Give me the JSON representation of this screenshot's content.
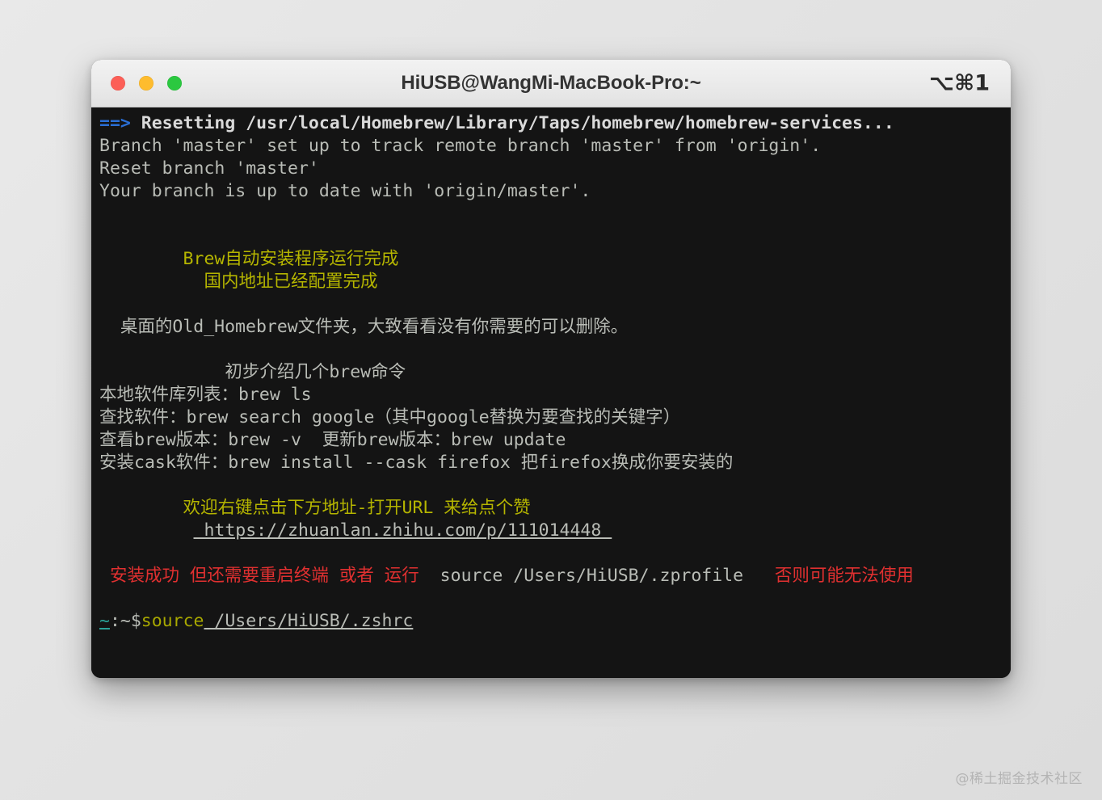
{
  "window": {
    "title": "HiUSB@WangMi-MacBook-Pro:~",
    "shortcut_badge": "⌥⌘1",
    "traffic_lights": {
      "close_label": "close",
      "minimize_label": "minimize",
      "maximize_label": "maximize",
      "close_color": "#fc5f57",
      "minimize_color": "#febc2e",
      "maximize_color": "#2bc840"
    }
  },
  "terminal": {
    "background_color": "#141414",
    "default_text_color": "#b9bcb6",
    "lines": {
      "l1_prefix": "==>",
      "l1_text": " Resetting /usr/local/Homebrew/Library/Taps/homebrew/homebrew-services...",
      "l2": "Branch 'master' set up to track remote branch 'master' from 'origin'.",
      "l3": "Reset branch 'master'",
      "l4": "Your branch is up to date with 'origin/master'.",
      "l5": "        Brew自动安装程序运行完成",
      "l6": "          国内地址已经配置完成",
      "l7": "  桌面的Old_Homebrew文件夹，大致看看没有你需要的可以删除。",
      "l8": "            初步介绍几个brew命令",
      "l9": "本地软件库列表：brew ls",
      "l10": "查找软件：brew search google（其中google替换为要查找的关键字）",
      "l11": "查看brew版本：brew -v  更新brew版本：brew update",
      "l12": "安装cask软件：brew install --cask firefox 把firefox换成你要安装的",
      "l13": "        欢迎右键点击下方地址-打开URL 来给点个赞",
      "l14_indent": "         ",
      "l14_url": " https://zhuanlan.zhihu.com/p/111014448 ",
      "l15_red_a": " 安装成功 但还需要重启终端 或者 运行 ",
      "l15_grey": " source /Users/HiUSB/.zprofile  ",
      "l15_red_b": " 否则可能无法使用",
      "prompt_host": "~",
      "prompt_sep": ":~$",
      "prompt_cmd": "source",
      "prompt_arg": " /Users/HiUSB/.zshrc"
    },
    "colors": {
      "blue": "#2a6fd6",
      "white": "#d9d9d9",
      "grey": "#b9bcb6",
      "yellow": "#b5b500",
      "red": "#e03030",
      "teal": "#2aa198"
    }
  },
  "watermark": {
    "text": "@稀土掘金技术社区"
  }
}
